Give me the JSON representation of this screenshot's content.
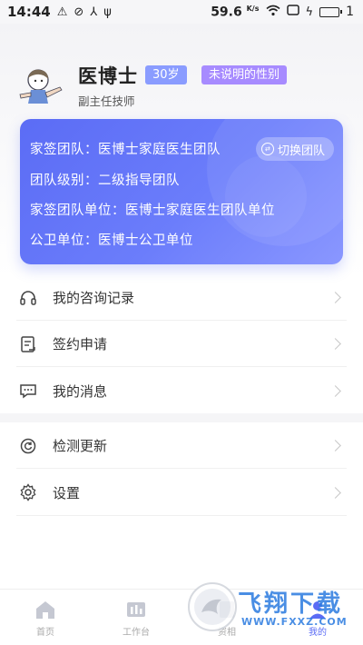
{
  "statusbar": {
    "time": "14:44",
    "speed": "59.6",
    "speed_unit": "K/s",
    "battery": "1"
  },
  "profile": {
    "name": "医博士",
    "age_badge": "30岁",
    "gender_badge": "未说明的性别",
    "job_title": "副主任技师"
  },
  "team_card": {
    "team_line": "家签团队：医博士家庭医生团队",
    "level_line": "团队级别：二级指导团队",
    "unit_line": "家签团队单位：医博士家庭医生团队单位",
    "public_health_line": "公卫单位：医博士公卫单位",
    "switch_label": "切换团队"
  },
  "menu": {
    "consult_records": "我的咨询记录",
    "sign_apply": "签约申请",
    "my_messages": "我的消息",
    "check_update": "检测更新",
    "settings": "设置"
  },
  "bottom_nav": {
    "home": "首页",
    "workbench": "工作台",
    "resources": "资相",
    "mine": "我的"
  },
  "watermark": {
    "text": "飞翔下载",
    "url": "WWW.FXXZ.COM"
  },
  "colors": {
    "accent": "#5b6cf5",
    "age_badge": "#8a9cff",
    "gender_badge": "#a78bff",
    "watermark": "#2b7be0"
  }
}
